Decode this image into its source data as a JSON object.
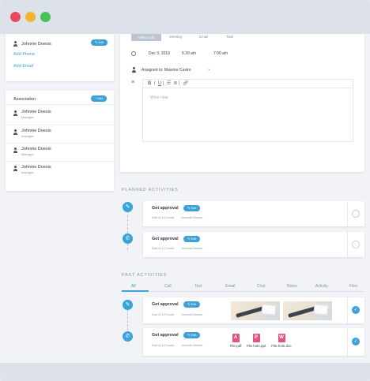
{
  "contact_card": {
    "person_name": "Johnnie Doesis",
    "edit_label": "Edit",
    "add_phone": "Add Phone",
    "add_email": "Add Email"
  },
  "association_card": {
    "title": "Association",
    "add_label": "+ Add",
    "people": [
      {
        "name": "Johnnie Doesis",
        "role": "Manager"
      },
      {
        "name": "Johnnie Doesis",
        "role": "manager"
      },
      {
        "name": "Johnnie Doesis",
        "role": "Manager"
      },
      {
        "name": "Johnnie Doesis",
        "role": "manager"
      }
    ]
  },
  "editor": {
    "tabs": [
      "Video Call",
      "Meeting",
      "Email",
      "Task"
    ],
    "date": "Dec 3, 2019",
    "time_start": "6:30 am",
    "time_end": "7:00 am",
    "assigned": "Assigned to: Maximo Castro",
    "placeholder": "Write note"
  },
  "planned": {
    "title": "PLANNED ACTIVITIES",
    "items": [
      {
        "title": "Get approval",
        "tag": "Edit",
        "meta": "Due in 12 hours",
        "user": "Johnnie Doesis"
      },
      {
        "title": "Get approval",
        "tag": "Edit",
        "meta": "Due in 12 hours",
        "user": "Johnnie Doesis"
      }
    ]
  },
  "past": {
    "title": "PAST ACTIVITIES",
    "filters": [
      "All",
      "Call",
      "Text",
      "Email",
      "Chat",
      "Notes",
      "Activity",
      "Files"
    ],
    "items": [
      {
        "title": "Get approval",
        "tag": "Edit",
        "meta": "Due in 12 hours",
        "user": "Johnnie Doesis"
      },
      {
        "title": "Get approval",
        "tag": "Edit",
        "meta": "Due in 12 hours",
        "user": "Johnnie Doesis"
      }
    ],
    "files": [
      "File.pdf",
      "File.hole.ppt",
      "File.hole.doc"
    ]
  },
  "colors": {
    "accent": "#3aa2d8",
    "file_icon": "#e4527e"
  }
}
